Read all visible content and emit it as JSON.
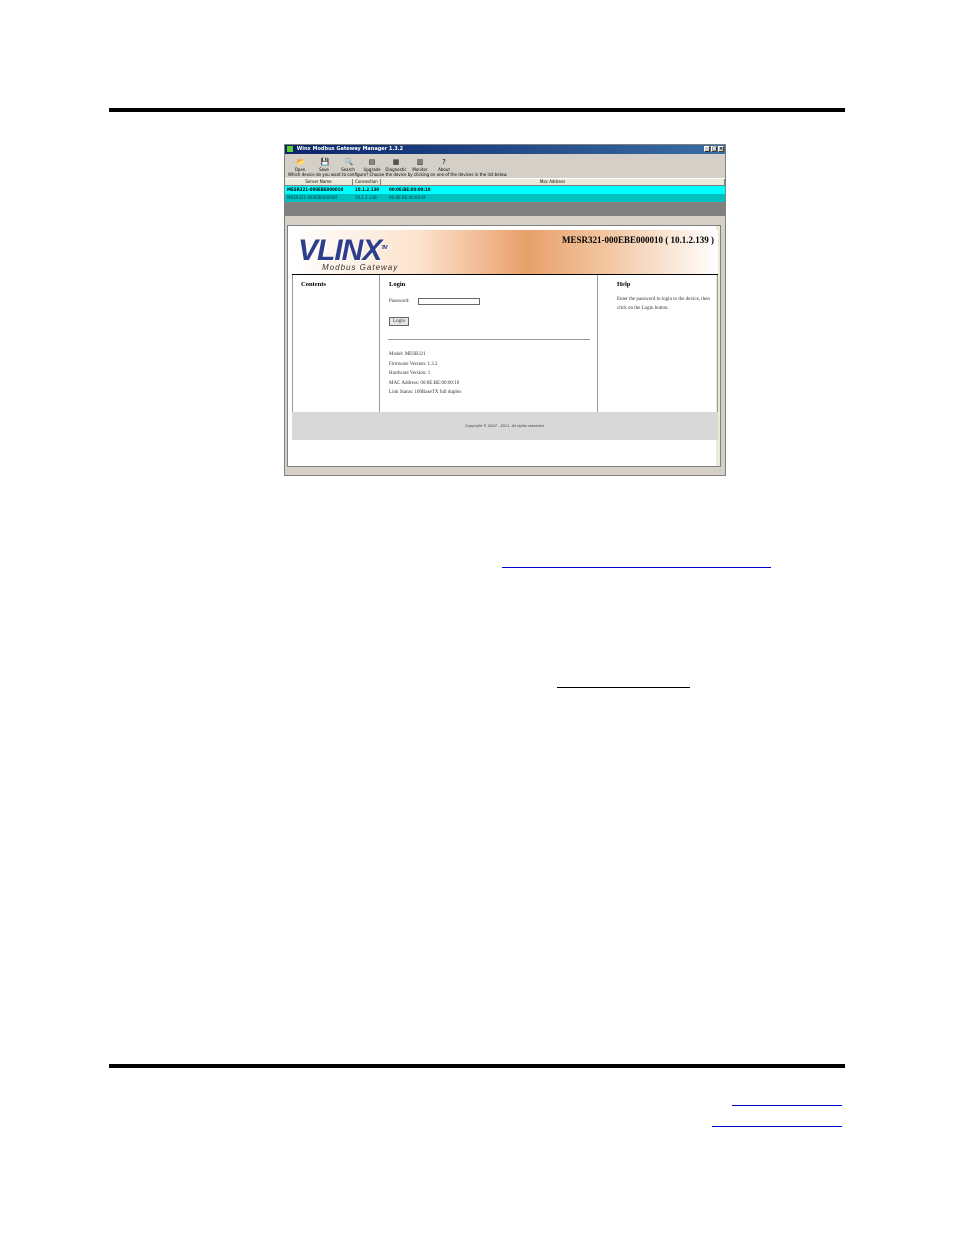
{
  "window": {
    "title": "Winx Modbus Gateway Manager 1.3.2",
    "buttons": [
      "_",
      "□",
      "×"
    ]
  },
  "toolbar": {
    "items": [
      {
        "label": "Open",
        "icon": "folder-open-icon",
        "glyph": "📂"
      },
      {
        "label": "Save",
        "icon": "save-icon",
        "glyph": "💾"
      },
      {
        "label": "Search",
        "icon": "search-icon",
        "glyph": "🔍"
      },
      {
        "label": "Upgrade",
        "icon": "upgrade-icon",
        "glyph": "▤"
      },
      {
        "label": "Diagnostic",
        "icon": "diagnostic-icon",
        "glyph": "▦"
      },
      {
        "label": "Monitor",
        "icon": "monitor-icon",
        "glyph": "▥"
      },
      {
        "label": "About",
        "icon": "help-icon",
        "glyph": "?"
      }
    ]
  },
  "prompt": "Which device do you want to configure? Choose the device by clicking on one of the devices in the list below.",
  "device_list": {
    "columns": [
      "Server Name",
      "Connection",
      "Mac Address"
    ],
    "rows": [
      {
        "name": "MESR321-000EBE000010",
        "connection": "10.1.2.139",
        "mac": "00:0E:BE:00:00:10"
      },
      {
        "name": "MESR321-000EBE00000F",
        "connection": "10.1.2.138",
        "mac": "00:0E:BE:00:00:0F"
      }
    ]
  },
  "web_page": {
    "logo": "VLINX",
    "logo_tm": "TM",
    "logo_subtitle": "Modbus Gateway",
    "device_header": "MESR321-000EBE000010 ( 10.1.2.139 )",
    "contents_title": "Contents",
    "login_title": "Login",
    "password_label": "Password:",
    "login_button": "Login",
    "info": [
      "Model: MESR321",
      "Firmware Version: 1.3.2",
      "Hardware Version: 1",
      "MAC Address: 00:0E:BE:00:00:10",
      "Link Status: 100BaseTX full duplex"
    ],
    "help_title": "Help",
    "help_text": "Enter the password to login to the device, then click on the Login button.",
    "copyright": "Copyright © 2007 - 2011. All rights reserved."
  },
  "colors": {
    "selected_row": "#00ffff",
    "second_row": "#00c0c0",
    "logo": "#2c3e8c"
  }
}
